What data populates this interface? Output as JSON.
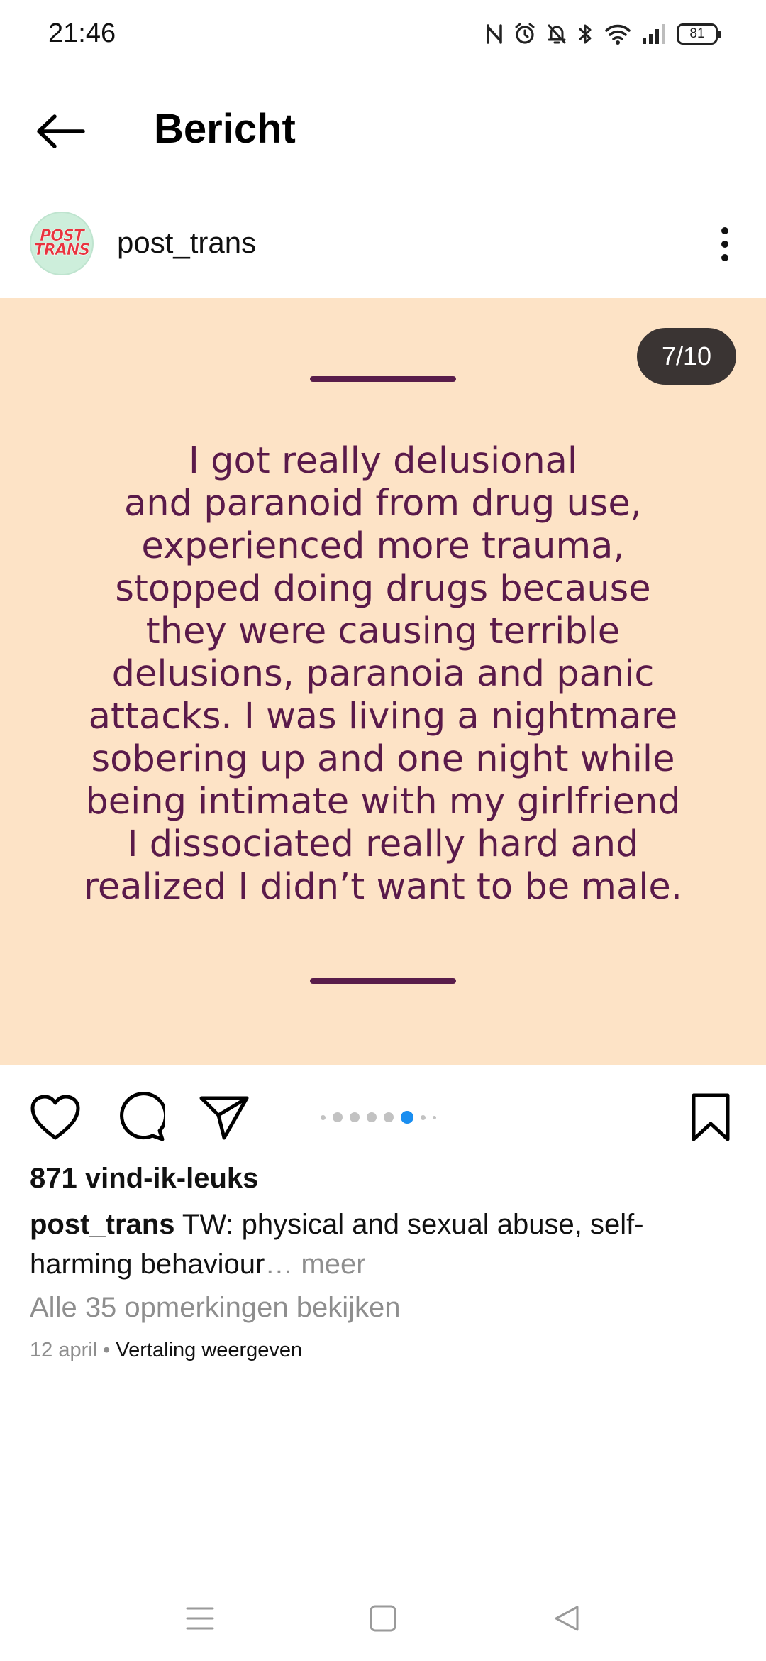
{
  "status_bar": {
    "time": "21:46",
    "battery_level": "81",
    "icons": [
      "nfc-icon",
      "alarm-icon",
      "bell-off-icon",
      "bluetooth-icon",
      "wifi-icon",
      "signal-icon",
      "battery-icon"
    ]
  },
  "header": {
    "title": "Bericht",
    "back_icon": "arrow-left-icon"
  },
  "post": {
    "author": "post_trans",
    "avatar_text_line1": "POST",
    "avatar_text_line2": "TRANS",
    "slide_counter": "7/10",
    "slide_text": "I got really delusional\nand paranoid from drug use,\nexperienced more trauma,\nstopped doing drugs because\nthey were causing terrible\ndelusions, paranoia and panic\nattacks. I was living a nightmare\nsobering up and one night while\nbeing intimate with my girlfriend\nI dissociated really hard and\nrealized I didn’t want to be male.",
    "slide_index": 7,
    "slide_total": 10,
    "likes": "871 vind-ik-leuks",
    "caption_user": "post_trans",
    "caption_text": " TW: physical and sexual abuse, self-harming behaviour",
    "caption_more": "… meer",
    "comments_link": "Alle 35 opmerkingen bekijken",
    "date": "12 april",
    "separator": " • ",
    "translate_link": "Vertaling weergeven"
  },
  "colors": {
    "slide_background": "#fde3c6",
    "slide_text": "#5a1a4a",
    "active_dot": "#1a8ef0",
    "counter_background": "#3a3433"
  }
}
